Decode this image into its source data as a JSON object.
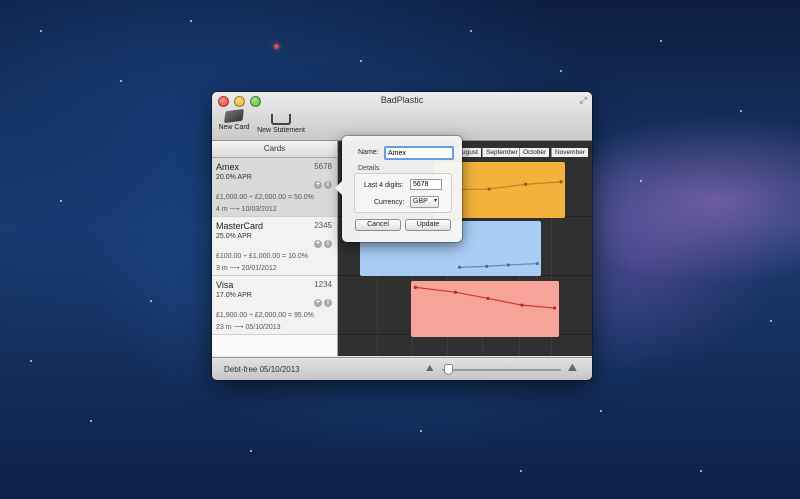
{
  "window": {
    "title": "BadPlastic",
    "toolbar": {
      "new_card": "New Card",
      "new_statement": "New Statement"
    }
  },
  "sidebar": {
    "header": "Cards",
    "cards": [
      {
        "name": "Amex",
        "digits": "5678",
        "apr": "20.0% APR",
        "balance": "£1,000.00 ÷ £2,000.00 = 50.0%",
        "term": "4 m ⟶ 10/03/2012",
        "selected": true
      },
      {
        "name": "MasterCard",
        "digits": "2345",
        "apr": "25.0% APR",
        "balance": "£100.00 ÷ £1,000.00 = 10.0%",
        "term": "3 m ⟶ 20/01/2012",
        "selected": false
      },
      {
        "name": "Visa",
        "digits": "1234",
        "apr": "17.0% APR",
        "balance": "£1,900.00 ÷ £2,000.00 = 95.0%",
        "term": "23 m ⟶ 05/10/2013",
        "selected": false
      }
    ]
  },
  "timeline": {
    "months": [
      "11",
      "ugust",
      "September",
      "October",
      "November"
    ],
    "series": [
      {
        "card": "Amex",
        "color": "#f3b23a",
        "values": [
          0.5,
          0.52,
          0.62,
          0.67
        ]
      },
      {
        "card": "MasterCard",
        "color": "#a9cdf5",
        "values": [
          0.1,
          0.12,
          0.15,
          0.18
        ]
      },
      {
        "card": "Visa",
        "color": "#f7a39a",
        "values": [
          0.95,
          0.85,
          0.72,
          0.58,
          0.52
        ]
      }
    ]
  },
  "status": {
    "debt_free": "Debt-free 05/10/2013",
    "zoom_level": 0.02
  },
  "popover": {
    "name_label": "Name:",
    "name_value": "Amex",
    "details_label": "Details",
    "last4_label": "Last 4 digits:",
    "last4_value": "5678",
    "currency_label": "Currency:",
    "currency_value": "GBP",
    "cancel": "Cancel",
    "update": "Update"
  },
  "icons": {
    "close": "close-icon",
    "minimize": "minimize-icon",
    "zoom": "zoom-icon",
    "fullscreen": "fullscreen-icon",
    "new_card": "credit-card-icon",
    "new_statement": "inbox-tray-icon",
    "add": "plus-icon",
    "info": "info-icon",
    "zoom_small": "zoom-out-icon",
    "zoom_large": "zoom-in-icon",
    "dropdown": "chevron-down-icon"
  }
}
